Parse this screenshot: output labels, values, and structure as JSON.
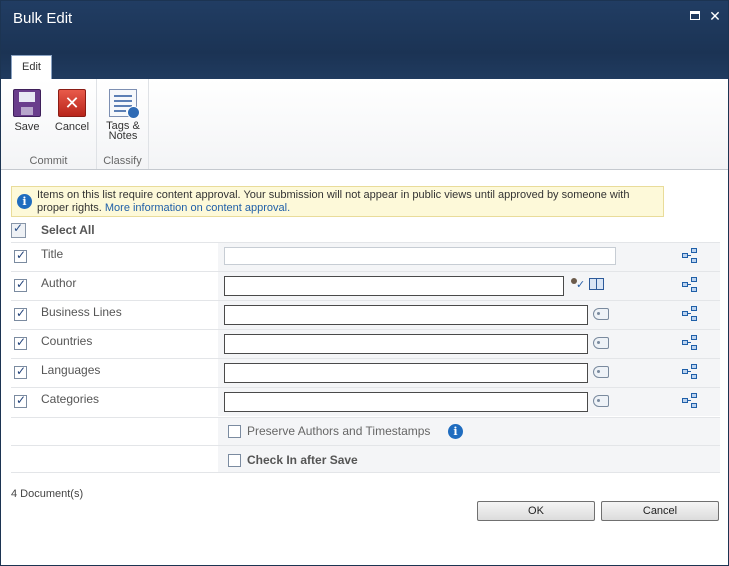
{
  "window": {
    "title": "Bulk Edit"
  },
  "ribbon": {
    "tab": "Edit",
    "save_label": "Save",
    "cancel_label": "Cancel",
    "tags_label_1": "Tags &",
    "tags_label_2": "Notes",
    "group_commit": "Commit",
    "group_classify": "Classify"
  },
  "notice": {
    "text": "Items on this list require content approval. Your submission will not appear in public views until approved by someone with proper rights.",
    "link": "More information on content approval."
  },
  "select_all": "Select All",
  "fields": [
    {
      "label": "Title",
      "value": "",
      "checked": true
    },
    {
      "label": "Author",
      "value": "",
      "checked": true
    },
    {
      "label": "Business Lines",
      "value": "",
      "checked": true
    },
    {
      "label": "Countries",
      "value": "",
      "checked": true
    },
    {
      "label": "Languages",
      "value": "",
      "checked": true
    },
    {
      "label": "Categories",
      "value": "",
      "checked": true
    }
  ],
  "options": {
    "preserve": "Preserve Authors and Timestamps",
    "checkin": "Check In after Save"
  },
  "doc_count": "4  Document(s)",
  "buttons": {
    "ok": "OK",
    "cancel": "Cancel"
  }
}
